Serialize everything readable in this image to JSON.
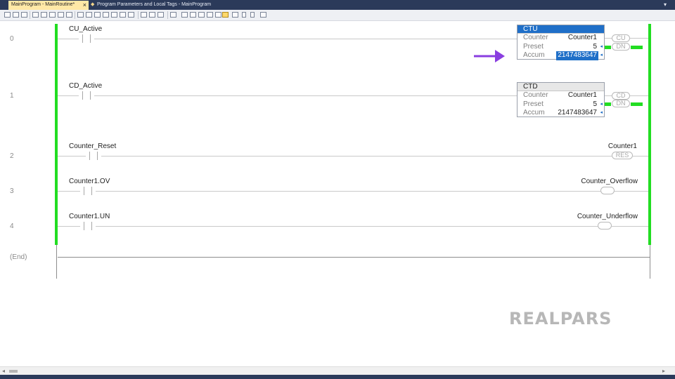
{
  "tabs": [
    {
      "label": "MainProgram - MainRoutine*"
    },
    {
      "label": "Program Parameters and Local Tags - MainProgram"
    }
  ],
  "rungs": [
    {
      "number": "0",
      "input_tag": "CU_Active"
    },
    {
      "number": "1",
      "input_tag": "CD_Active"
    },
    {
      "number": "2",
      "input_tag": "Counter_Reset",
      "output_tag": "Counter1",
      "output_coil": "RES"
    },
    {
      "number": "3",
      "input_tag": "Counter1.OV",
      "output_tag": "Counter_Overflow"
    },
    {
      "number": "4",
      "input_tag": "Counter1.UN",
      "output_tag": "Counter_Underflow"
    }
  ],
  "ctu": {
    "title": "CTU",
    "counter_label": "Counter",
    "counter_value": "Counter1",
    "preset_label": "Preset",
    "preset_value": "5",
    "accum_label": "Accum",
    "accum_value": "2147483647",
    "out_cu": "CU",
    "out_dn": "DN"
  },
  "ctd": {
    "title": "CTD",
    "counter_label": "Counter",
    "counter_value": "Counter1",
    "preset_label": "Preset",
    "preset_value": "5",
    "accum_label": "Accum",
    "accum_value": "2147483647",
    "out_cd": "CD",
    "out_dn": "DN"
  },
  "end_label": "(End)",
  "watermark": "REALPARS",
  "colors": {
    "rail_energized": "#22dd22",
    "selected_block": "#1f6fc8",
    "arrow": "#8a3ee0"
  }
}
